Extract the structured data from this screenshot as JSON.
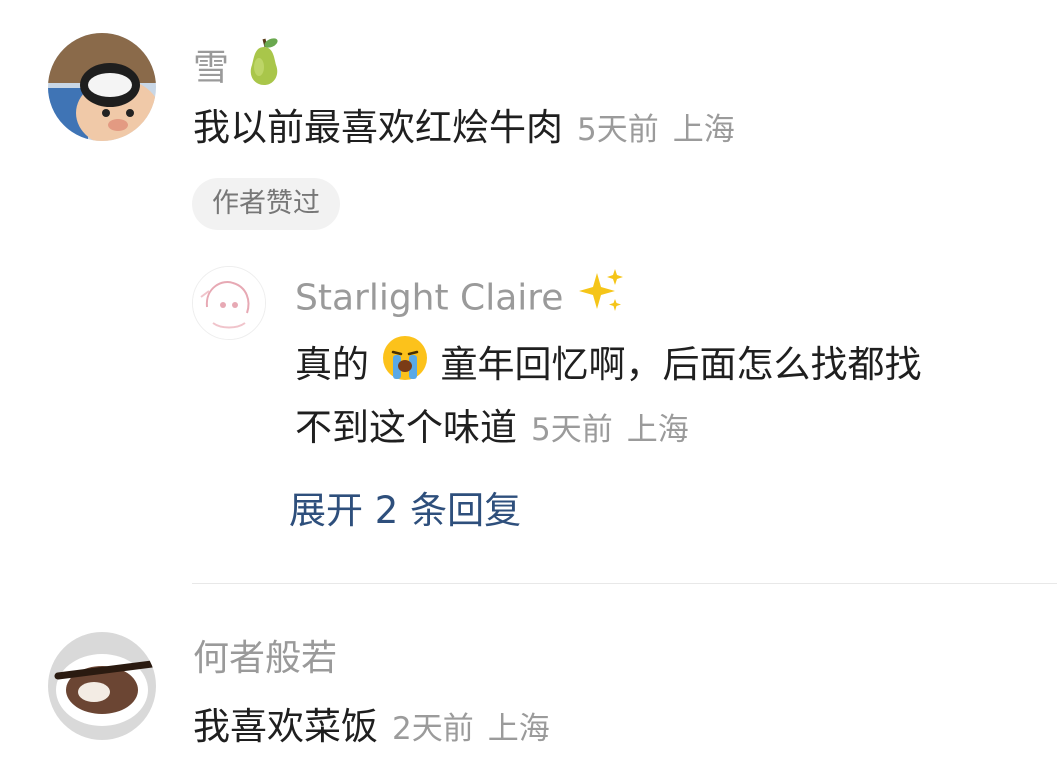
{
  "comments": [
    {
      "username": "雪",
      "username_emoji": "pear-icon",
      "text": "我以前最喜欢红烩牛肉",
      "time": "5天前",
      "location": "上海",
      "badge": "作者赞过",
      "replies": [
        {
          "username": "Starlight Claire",
          "username_emoji": "sparkles-icon",
          "text_part1": "真的",
          "text_emoji": "loudly-crying-face-icon",
          "text_part2": "童年回忆啊，后面怎么找都找",
          "text_line2": "不到这个味道",
          "time": "5天前",
          "location": "上海"
        }
      ],
      "expand_replies_label": "展开 2 条回复"
    },
    {
      "username": "何者般若",
      "text": "我喜欢菜饭",
      "time": "2天前",
      "location": "上海"
    }
  ],
  "colors": {
    "username": "#9a9a9a",
    "text": "#1f1f1f",
    "meta": "#9b9b9b",
    "link": "#2e4f7c",
    "badge_bg": "#f2f2f2"
  }
}
